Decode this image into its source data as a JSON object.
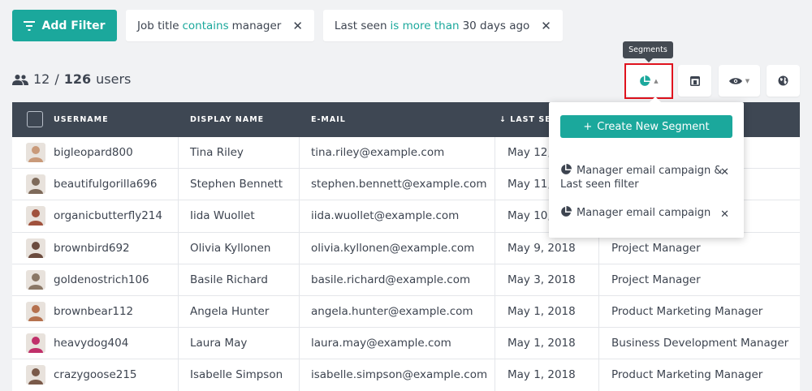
{
  "filters_bar": {
    "add_filter_label": "Add Filter",
    "chips": [
      {
        "field": "Job title",
        "op": "contains",
        "value": "manager"
      },
      {
        "field": "Last seen",
        "op": "is more than",
        "value": "30 days ago"
      }
    ]
  },
  "count": {
    "shown": "12",
    "sep": "/",
    "total": "126",
    "unit": "users"
  },
  "tooltip": "Segments",
  "table": {
    "headers": [
      "USERNAME",
      "DISPLAY NAME",
      "E-MAIL",
      "LAST SEEN"
    ],
    "rows": [
      {
        "username": "bigleopard800",
        "display": "Tina Riley",
        "email": "tina.riley@example.com",
        "seen": "May 12,",
        "job": "er"
      },
      {
        "username": "beautifulgorilla696",
        "display": "Stephen Bennett",
        "email": "stephen.bennett@example.com",
        "seen": "May 11,",
        "job": "anager"
      },
      {
        "username": "organicbutterfly214",
        "display": "Iida Wuollet",
        "email": "iida.wuollet@example.com",
        "seen": "May 10,",
        "job": ""
      },
      {
        "username": "brownbird692",
        "display": "Olivia Kyllonen",
        "email": "olivia.kyllonen@example.com",
        "seen": "May 9, 2018",
        "job": "Project Manager"
      },
      {
        "username": "goldenostrich106",
        "display": "Basile Richard",
        "email": "basile.richard@example.com",
        "seen": "May 3, 2018",
        "job": "Project Manager"
      },
      {
        "username": "brownbear112",
        "display": "Angela Hunter",
        "email": "angela.hunter@example.com",
        "seen": "May 1, 2018",
        "job": "Product Marketing Manager"
      },
      {
        "username": "heavydog404",
        "display": "Laura May",
        "email": "laura.may@example.com",
        "seen": "May 1, 2018",
        "job": "Business Development Manager"
      },
      {
        "username": "crazygoose215",
        "display": "Isabelle Simpson",
        "email": "isabelle.simpson@example.com",
        "seen": "May 1, 2018",
        "job": "Product Marketing Manager"
      }
    ]
  },
  "segments": {
    "create_label": "Create New Segment",
    "items": [
      {
        "label": "Manager email campaign & Last seen filter"
      },
      {
        "label": "Manager email campaign"
      }
    ]
  },
  "colors": {
    "accent": "#1ba89c",
    "header": "#3e4753",
    "highlight": "#e0131e"
  }
}
